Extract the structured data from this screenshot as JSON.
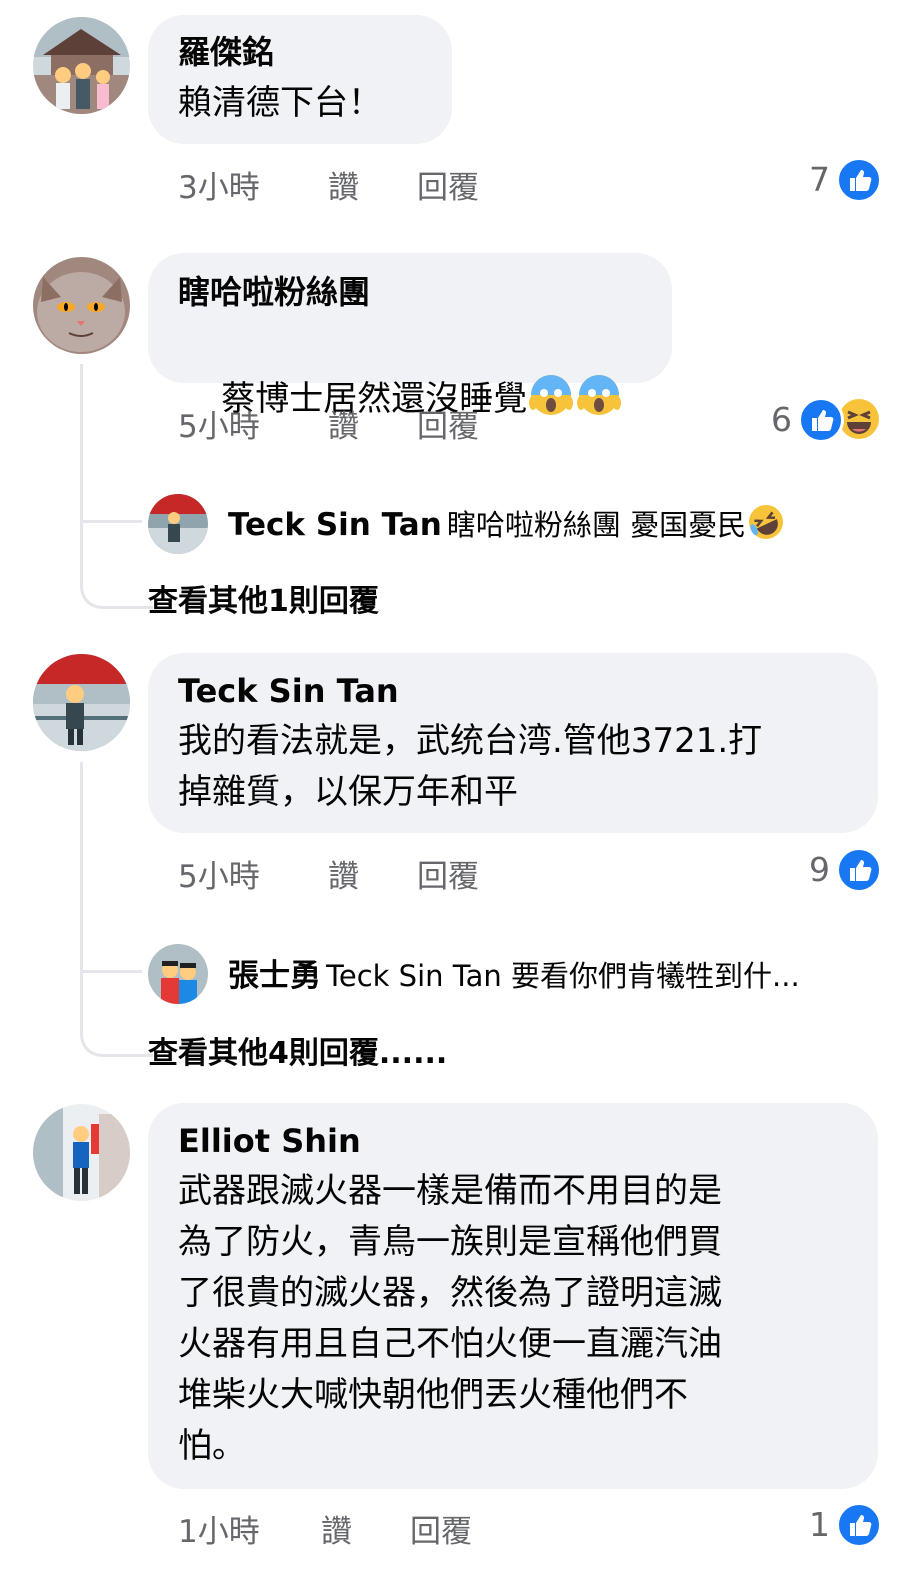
{
  "comments": [
    {
      "author": "羅傑銘",
      "text": "賴清德下台！",
      "time": "3小時",
      "like_label": "讚",
      "reply_label": "回覆",
      "count": "7"
    },
    {
      "author": "瞎哈啦粉絲團",
      "text": "蔡博士居然還沒睡覺",
      "time": "5小時",
      "like_label": "讚",
      "reply_label": "回覆",
      "count": "6",
      "reply": {
        "author": "Teck Sin Tan",
        "text": "瞎哈啦粉絲團 憂国憂民"
      },
      "more": "查看其他1則回覆"
    },
    {
      "author": "Teck Sin Tan",
      "text": "我的看法就是，武统台湾.管他3721.打\n掉雜質，以保万年和平",
      "time": "5小時",
      "like_label": "讚",
      "reply_label": "回覆",
      "count": "9",
      "reply": {
        "author": "張士勇",
        "text": "Teck Sin Tan 要看你們肯犧牲到什..."
      },
      "more": "查看其他4則回覆......"
    },
    {
      "author": "Elliot Shin",
      "text": "武器跟滅火器一樣是備而不用目的是\n為了防火，青鳥一族則是宣稱他們買\n了很貴的滅火器，然後為了證明這滅\n火器有用且自己不怕火便一直灑汽油\n堆柴火大喊快朝他們丟火種他們不\n怕。",
      "time": "1小時",
      "like_label": "讚",
      "reply_label": "回覆",
      "count": "1"
    }
  ],
  "icons": {
    "like": "thumbs-up-icon",
    "haha": "haha-emoji-icon",
    "scream": "scream-emoji-icon",
    "rofl": "rofl-emoji-icon"
  },
  "colors": {
    "bubble": "#f0f2f5",
    "like_blue": "#1877f2",
    "meta": "#65676b",
    "emoji_yellow": "#f7c33b"
  }
}
